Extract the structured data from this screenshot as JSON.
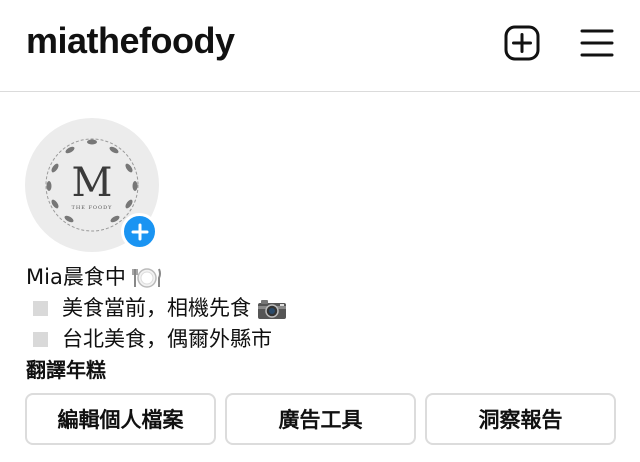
{
  "header": {
    "username": "miathefoody",
    "new_post_icon": "plus-square-icon",
    "menu_icon": "hamburger-menu-icon"
  },
  "profile": {
    "avatar_letter": "M",
    "avatar_caption": "THE FOODY",
    "add_story_icon": "plus-icon",
    "accent_color": "#1a94f2"
  },
  "bio": {
    "name": "Mia晨食中",
    "name_emoji": "plate-cutlery-icon",
    "lines": [
      {
        "text": "美食當前，相機先食",
        "emoji": "camera-icon"
      },
      {
        "text": "台北美食，偶爾外縣市"
      }
    ],
    "translate_label": "翻譯年糕"
  },
  "actions": {
    "edit_profile": "編輯個人檔案",
    "ad_tools": "廣告工具",
    "insights": "洞察報告"
  }
}
